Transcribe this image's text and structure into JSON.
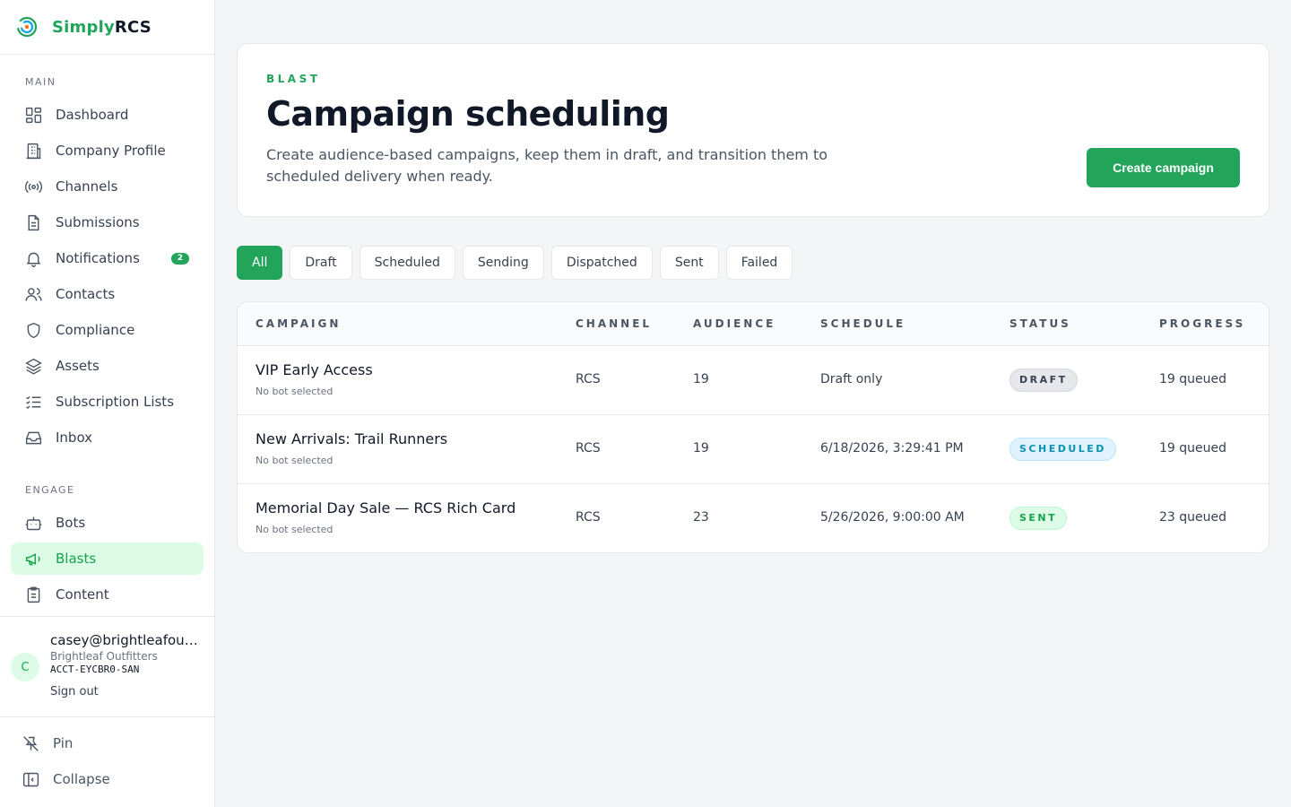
{
  "brand": {
    "name_a": "Simply",
    "name_b": "RCS",
    "accent": "#22a55b"
  },
  "sidebar": {
    "main_label": "MAIN",
    "main_items": [
      {
        "label": "Dashboard",
        "icon": "dashboard-icon"
      },
      {
        "label": "Company Profile",
        "icon": "building-icon"
      },
      {
        "label": "Channels",
        "icon": "broadcast-icon"
      },
      {
        "label": "Submissions",
        "icon": "document-icon"
      },
      {
        "label": "Notifications",
        "icon": "bell-icon",
        "badge": "2"
      },
      {
        "label": "Contacts",
        "icon": "users-icon"
      },
      {
        "label": "Compliance",
        "icon": "shield-icon"
      },
      {
        "label": "Assets",
        "icon": "layers-icon"
      },
      {
        "label": "Subscription Lists",
        "icon": "checklist-icon"
      },
      {
        "label": "Inbox",
        "icon": "inbox-icon"
      }
    ],
    "engage_label": "ENGAGE",
    "engage_items": [
      {
        "label": "Bots",
        "icon": "bot-icon"
      },
      {
        "label": "Blasts",
        "icon": "megaphone-icon",
        "active": true
      },
      {
        "label": "Content",
        "icon": "clipboard-icon"
      }
    ]
  },
  "account": {
    "initial": "C",
    "email": "casey@brightleafoutfitters.com",
    "company": "Brightleaf Outfitters",
    "account_id": "ACCT-EYCBR0-SAN",
    "sign_out": "Sign out"
  },
  "footer": {
    "pin": "Pin",
    "collapse": "Collapse"
  },
  "hero": {
    "eyebrow": "BLAST",
    "title": "Campaign scheduling",
    "subtitle": "Create audience-based campaigns, keep them in draft, and transition them to scheduled delivery when ready.",
    "cta": "Create campaign"
  },
  "filters": [
    "All",
    "Draft",
    "Scheduled",
    "Sending",
    "Dispatched",
    "Sent",
    "Failed"
  ],
  "active_filter": "All",
  "table": {
    "columns": [
      "CAMPAIGN",
      "CHANNEL",
      "AUDIENCE",
      "SCHEDULE",
      "STATUS",
      "PROGRESS"
    ],
    "rows": [
      {
        "name": "VIP Early Access",
        "bot": "No bot selected",
        "channel": "RCS",
        "audience": "19",
        "schedule": "Draft only",
        "status": "DRAFT",
        "status_kind": "draft",
        "progress": "19 queued"
      },
      {
        "name": "New Arrivals: Trail Runners",
        "bot": "No bot selected",
        "channel": "RCS",
        "audience": "19",
        "schedule": "6/18/2026, 3:29:41 PM",
        "status": "SCHEDULED",
        "status_kind": "scheduled",
        "progress": "19 queued"
      },
      {
        "name": "Memorial Day Sale — RCS Rich Card",
        "bot": "No bot selected",
        "channel": "RCS",
        "audience": "23",
        "schedule": "5/26/2026, 9:00:00 AM",
        "status": "SENT",
        "status_kind": "sent",
        "progress": "23 queued"
      }
    ]
  }
}
